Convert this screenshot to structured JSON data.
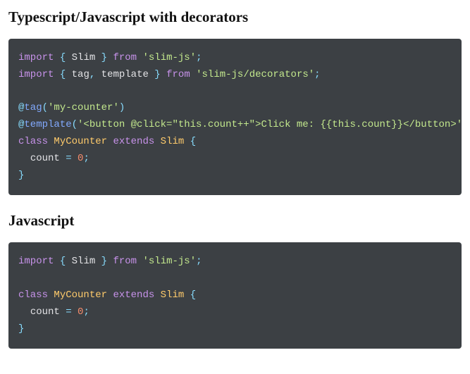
{
  "sections": [
    {
      "heading": "Typescript/Javascript with decorators",
      "code_lines": [
        [
          {
            "t": "import",
            "c": "tok-kw"
          },
          {
            "t": " ",
            "c": "tok-plain"
          },
          {
            "t": "{",
            "c": "tok-pun"
          },
          {
            "t": " ",
            "c": "tok-plain"
          },
          {
            "t": "Slim",
            "c": "tok-id"
          },
          {
            "t": " ",
            "c": "tok-plain"
          },
          {
            "t": "}",
            "c": "tok-pun"
          },
          {
            "t": " ",
            "c": "tok-plain"
          },
          {
            "t": "from",
            "c": "tok-kw"
          },
          {
            "t": " ",
            "c": "tok-plain"
          },
          {
            "t": "'slim-js'",
            "c": "tok-str"
          },
          {
            "t": ";",
            "c": "tok-pun"
          }
        ],
        [
          {
            "t": "import",
            "c": "tok-kw"
          },
          {
            "t": " ",
            "c": "tok-plain"
          },
          {
            "t": "{",
            "c": "tok-pun"
          },
          {
            "t": " ",
            "c": "tok-plain"
          },
          {
            "t": "tag",
            "c": "tok-id"
          },
          {
            "t": ",",
            "c": "tok-pun"
          },
          {
            "t": " ",
            "c": "tok-plain"
          },
          {
            "t": "template",
            "c": "tok-id"
          },
          {
            "t": " ",
            "c": "tok-plain"
          },
          {
            "t": "}",
            "c": "tok-pun"
          },
          {
            "t": " ",
            "c": "tok-plain"
          },
          {
            "t": "from",
            "c": "tok-kw"
          },
          {
            "t": " ",
            "c": "tok-plain"
          },
          {
            "t": "'slim-js/decorators'",
            "c": "tok-str"
          },
          {
            "t": ";",
            "c": "tok-pun"
          }
        ],
        [],
        [
          {
            "t": "@",
            "c": "tok-at"
          },
          {
            "t": "tag",
            "c": "tok-dec"
          },
          {
            "t": "(",
            "c": "tok-pun"
          },
          {
            "t": "'my-counter'",
            "c": "tok-str"
          },
          {
            "t": ")",
            "c": "tok-pun"
          }
        ],
        [
          {
            "t": "@",
            "c": "tok-at"
          },
          {
            "t": "template",
            "c": "tok-dec"
          },
          {
            "t": "(",
            "c": "tok-pun"
          },
          {
            "t": "'<button @click=\"this.count++\">Click me: {{this.count}}</button>'",
            "c": "tok-str"
          },
          {
            "t": ")",
            "c": "tok-pun"
          }
        ],
        [
          {
            "t": "class",
            "c": "tok-kw"
          },
          {
            "t": " ",
            "c": "tok-plain"
          },
          {
            "t": "MyCounter",
            "c": "tok-cls"
          },
          {
            "t": " ",
            "c": "tok-plain"
          },
          {
            "t": "extends",
            "c": "tok-kw"
          },
          {
            "t": " ",
            "c": "tok-plain"
          },
          {
            "t": "Slim",
            "c": "tok-cls"
          },
          {
            "t": " ",
            "c": "tok-plain"
          },
          {
            "t": "{",
            "c": "tok-pun"
          }
        ],
        [
          {
            "t": "  ",
            "c": "tok-plain"
          },
          {
            "t": "count",
            "c": "tok-mem"
          },
          {
            "t": " ",
            "c": "tok-plain"
          },
          {
            "t": "=",
            "c": "tok-op"
          },
          {
            "t": " ",
            "c": "tok-plain"
          },
          {
            "t": "0",
            "c": "tok-num"
          },
          {
            "t": ";",
            "c": "tok-pun"
          }
        ],
        [
          {
            "t": "}",
            "c": "tok-pun"
          }
        ]
      ]
    },
    {
      "heading": "Javascript",
      "code_lines": [
        [
          {
            "t": "import",
            "c": "tok-kw"
          },
          {
            "t": " ",
            "c": "tok-plain"
          },
          {
            "t": "{",
            "c": "tok-pun"
          },
          {
            "t": " ",
            "c": "tok-plain"
          },
          {
            "t": "Slim",
            "c": "tok-id"
          },
          {
            "t": " ",
            "c": "tok-plain"
          },
          {
            "t": "}",
            "c": "tok-pun"
          },
          {
            "t": " ",
            "c": "tok-plain"
          },
          {
            "t": "from",
            "c": "tok-kw"
          },
          {
            "t": " ",
            "c": "tok-plain"
          },
          {
            "t": "'slim-js'",
            "c": "tok-str"
          },
          {
            "t": ";",
            "c": "tok-pun"
          }
        ],
        [],
        [
          {
            "t": "class",
            "c": "tok-kw"
          },
          {
            "t": " ",
            "c": "tok-plain"
          },
          {
            "t": "MyCounter",
            "c": "tok-cls"
          },
          {
            "t": " ",
            "c": "tok-plain"
          },
          {
            "t": "extends",
            "c": "tok-kw"
          },
          {
            "t": " ",
            "c": "tok-plain"
          },
          {
            "t": "Slim",
            "c": "tok-cls"
          },
          {
            "t": " ",
            "c": "tok-plain"
          },
          {
            "t": "{",
            "c": "tok-pun"
          }
        ],
        [
          {
            "t": "  ",
            "c": "tok-plain"
          },
          {
            "t": "count",
            "c": "tok-mem"
          },
          {
            "t": " ",
            "c": "tok-plain"
          },
          {
            "t": "=",
            "c": "tok-op"
          },
          {
            "t": " ",
            "c": "tok-plain"
          },
          {
            "t": "0",
            "c": "tok-num"
          },
          {
            "t": ";",
            "c": "tok-pun"
          }
        ],
        [
          {
            "t": "}",
            "c": "tok-pun"
          }
        ]
      ]
    }
  ]
}
